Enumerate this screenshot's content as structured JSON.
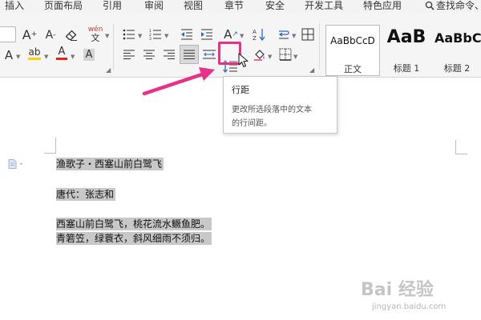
{
  "menubar": {
    "items": [
      "插入",
      "页面布局",
      "引用",
      "审阅",
      "视图",
      "章节",
      "安全",
      "开发工具",
      "特色应用"
    ],
    "search_label": "查找命令、"
  },
  "ribbon": {
    "font": {
      "grow_label": "A",
      "shrink_label": "A",
      "phonetic_label": "wén",
      "text_effect_label": "A",
      "highlight_label": "ab",
      "font_color_label": "A",
      "char_shading_label": "A"
    },
    "paragraph": {
      "direction_label": "A"
    },
    "styles": [
      {
        "sample": "AaBbCcD",
        "label": "正文"
      },
      {
        "sample": "AaB",
        "label": "标题 1"
      },
      {
        "sample": "AaBbC",
        "label": "标题 2"
      }
    ]
  },
  "tooltip": {
    "title": "行距",
    "description_line1": "更改所选段落中的文本",
    "description_line2": "的行间距。"
  },
  "document": {
    "lines": [
      "渔歌子・西塞山前白鹭飞",
      "唐代：张志和",
      "西塞山前白鹭飞，桃花流水鳜鱼肥。",
      "青箬笠，绿蓑衣，斜风细雨不须归。"
    ]
  },
  "watermark": {
    "main": "Bai 经验",
    "url": "jingyan.baidu.com"
  },
  "colors": {
    "annotation_pink": "#e8328a",
    "highlight_yellow": "#f5d20a",
    "font_red": "#e0261b",
    "selection_gray": "#c8c8c8"
  },
  "icons": [
    "search-icon",
    "eraser-icon",
    "bullets-icon",
    "numbering-icon",
    "outdent-icon",
    "indent-icon",
    "sort-icon",
    "paragraph-mark-icon",
    "align-left-icon",
    "align-center-icon",
    "align-right-icon",
    "justify-icon",
    "distributed-icon",
    "line-spacing-icon",
    "fill-icon",
    "borders-icon",
    "table-icon",
    "mouse-pointer-icon",
    "document-icon"
  ]
}
